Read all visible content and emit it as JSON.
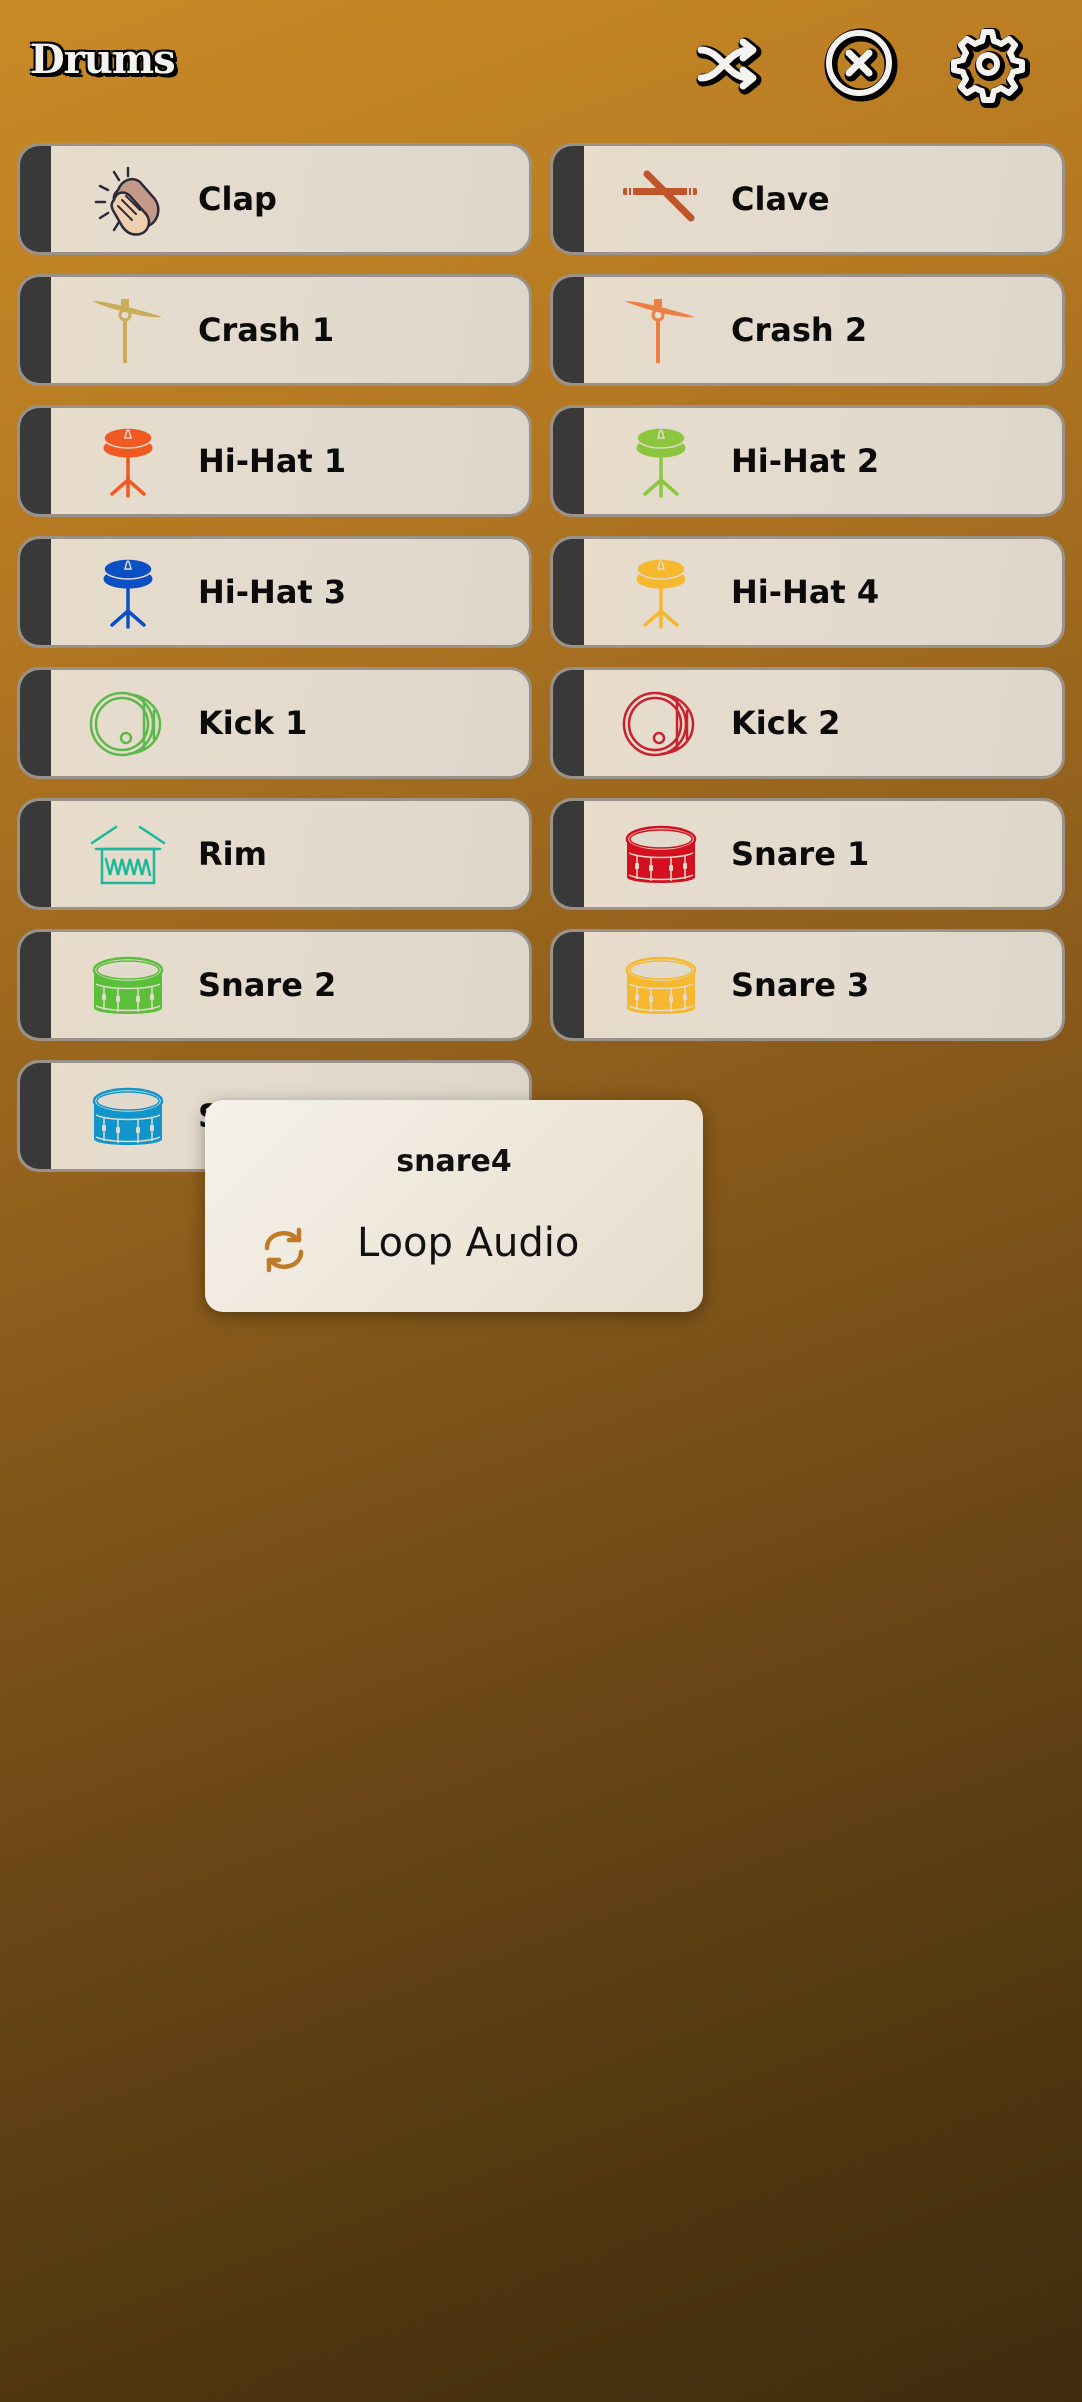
{
  "header": {
    "title": "Drums",
    "actions": [
      {
        "name": "shuffle",
        "icon": "shuffle-icon"
      },
      {
        "name": "stop-all",
        "icon": "close-circle-icon"
      },
      {
        "name": "settings",
        "icon": "gear-icon"
      }
    ]
  },
  "pads": [
    {
      "label": "Clap",
      "icon": "clap-icon",
      "color": "#e8c4a0"
    },
    {
      "label": "Clave",
      "icon": "clave-icon",
      "color": "#c0542a"
    },
    {
      "label": "Crash 1",
      "icon": "cymbal-icon",
      "color": "#c9ad5a"
    },
    {
      "label": "Crash 2",
      "icon": "cymbal-icon",
      "color": "#ec7f42"
    },
    {
      "label": "Hi-Hat 1",
      "icon": "hihat-icon",
      "color": "#f05a22"
    },
    {
      "label": "Hi-Hat 2",
      "icon": "hihat-icon",
      "color": "#8cc63f"
    },
    {
      "label": "Hi-Hat 3",
      "icon": "hihat-icon",
      "color": "#0b4fc4"
    },
    {
      "label": "Hi-Hat 4",
      "icon": "hihat-icon",
      "color": "#f5b82e"
    },
    {
      "label": "Kick 1",
      "icon": "kick-drum-icon",
      "color": "#5cb84a"
    },
    {
      "label": "Kick 2",
      "icon": "kick-drum-icon",
      "color": "#c8222e"
    },
    {
      "label": "Rim",
      "icon": "rim-drum-icon",
      "color": "#1cb89a"
    },
    {
      "label": "Snare 1",
      "icon": "snare-drum-icon",
      "color": "#d4101e"
    },
    {
      "label": "Snare 2",
      "icon": "snare-drum-icon",
      "color": "#5cbf3a"
    },
    {
      "label": "Snare 3",
      "icon": "snare-drum-icon",
      "color": "#f5b82e"
    },
    {
      "label": "Snare 4",
      "icon": "snare-drum-icon",
      "color": "#1196cc"
    }
  ],
  "popup": {
    "title": "snare4",
    "items": [
      {
        "label": "Loop Audio",
        "icon": "loop-icon",
        "color": "#c07a28"
      }
    ]
  }
}
